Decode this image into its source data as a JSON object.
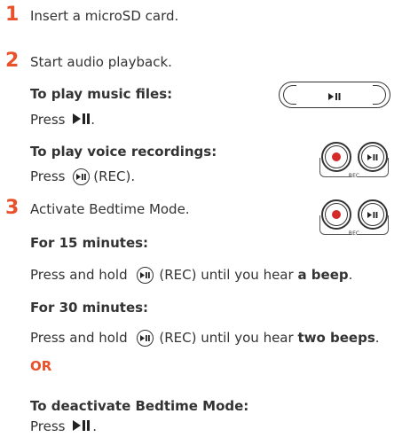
{
  "steps": [
    {
      "number": "1",
      "text": "Insert a microSD card."
    },
    {
      "number": "2",
      "text": "Start audio playback."
    },
    {
      "number": "3",
      "text": "Activate Bedtime Mode."
    }
  ],
  "music": {
    "heading": "To play music files:",
    "press": "Press",
    "period": "."
  },
  "voice": {
    "heading": "To play voice recordings:",
    "press": "Press",
    "rec": "(REC)."
  },
  "bedtime": {
    "fifteen": {
      "heading": "For 15 minutes:",
      "press": "Press and hold",
      "mid": "(REC) until you hear",
      "end": "a beep",
      "period": "."
    },
    "thirty": {
      "heading": "For 30 minutes:",
      "press": "Press and hold",
      "mid": "(REC) until you hear",
      "end": "two beeps",
      "period": "."
    },
    "or": "OR",
    "deactivate": {
      "heading": "To deactivate Bedtime Mode:",
      "press": "Press",
      "period": "."
    }
  },
  "rec_label": "REC",
  "colors": {
    "accent": "#e8512a",
    "record": "#d42a2a",
    "text": "#333333"
  },
  "icons": {
    "play_pause": "play-pause-icon",
    "record": "record-dot-icon"
  }
}
